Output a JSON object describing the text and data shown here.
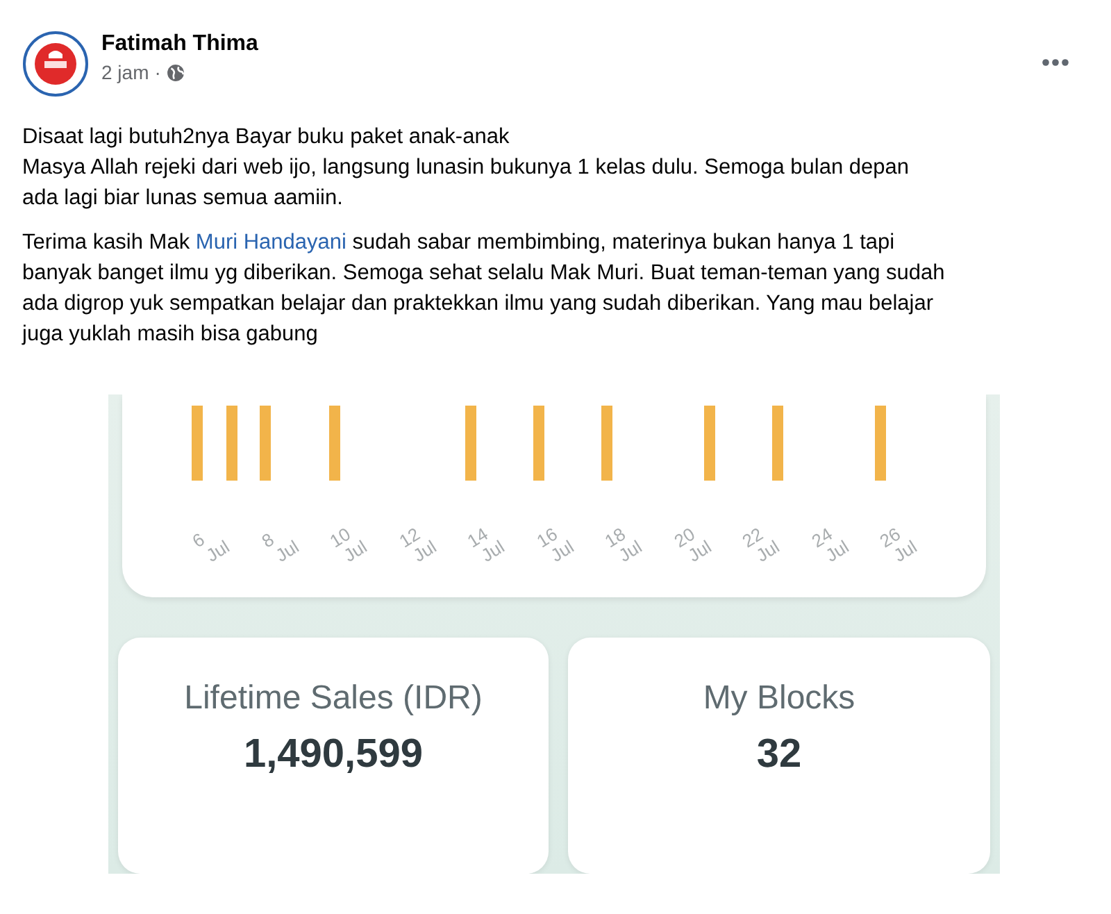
{
  "post": {
    "author": "Fatimah Thima",
    "time": "2 jam",
    "separator": "·",
    "paragraphs": [
      {
        "parts": [
          {
            "kind": "text",
            "text": "Disaat lagi butuh2nya Bayar buku paket anak-anak"
          },
          {
            "kind": "break"
          },
          {
            "kind": "text",
            "text": "Masya Allah rejeki dari web ijo, langsung lunasin bukunya  1 kelas dulu. Semoga bulan depan ada lagi biar lunas semua aamiin."
          }
        ]
      },
      {
        "parts": [
          {
            "kind": "text",
            "text": "Terima kasih Mak "
          },
          {
            "kind": "link",
            "text": "Muri Handayani"
          },
          {
            "kind": "text",
            "text": " sudah sabar membimbing, materinya bukan hanya 1 tapi banyak banget ilmu yg diberikan. Semoga sehat selalu Mak Muri. Buat teman-teman yang sudah ada digrop yuk sempatkan belajar dan praktekkan ilmu yang sudah diberikan. Yang mau belajar juga yuklah masih bisa gabung"
          }
        ]
      }
    ]
  },
  "app": {
    "x_labels": [
      {
        "day": "6",
        "month": "Jul"
      },
      {
        "day": "8",
        "month": "Jul"
      },
      {
        "day": "10",
        "month": "Jul"
      },
      {
        "day": "12",
        "month": "Jul"
      },
      {
        "day": "14",
        "month": "Jul"
      },
      {
        "day": "16",
        "month": "Jul"
      },
      {
        "day": "18",
        "month": "Jul"
      },
      {
        "day": "20",
        "month": "Jul"
      },
      {
        "day": "22",
        "month": "Jul"
      },
      {
        "day": "24",
        "month": "Jul"
      },
      {
        "day": "26",
        "month": "Jul"
      }
    ],
    "stats": [
      {
        "label": "Lifetime Sales (IDR)",
        "value": "1,490,599"
      },
      {
        "label": "My Blocks",
        "value": "32"
      }
    ]
  }
}
